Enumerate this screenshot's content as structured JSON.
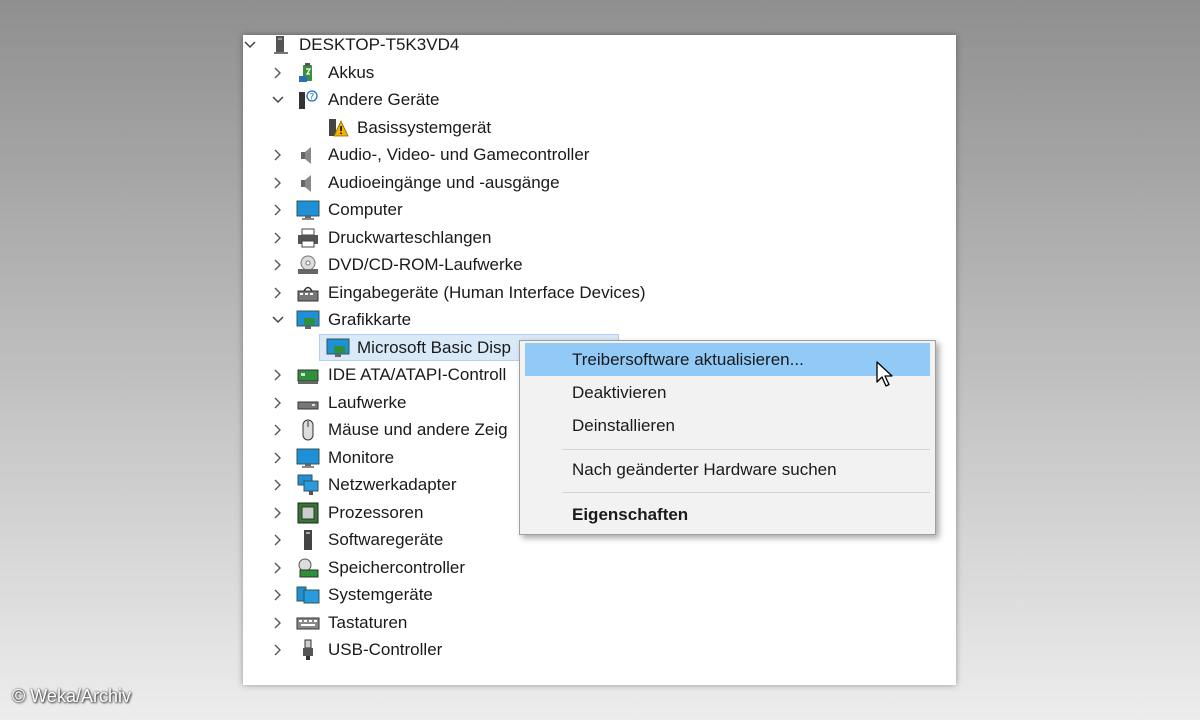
{
  "tree": {
    "root": "DESKTOP-T5K3VD4",
    "items": [
      {
        "label": "Akkus",
        "expanded": false,
        "icon": "battery-icon"
      },
      {
        "label": "Andere Geräte",
        "expanded": true,
        "icon": "unknown-device-icon"
      },
      {
        "label": "Basissystemgerät",
        "child": true,
        "icon": "warning-device-icon"
      },
      {
        "label": "Audio-, Video- und Gamecontroller",
        "expanded": false,
        "icon": "speaker-icon"
      },
      {
        "label": "Audioeingänge und -ausgänge",
        "expanded": false,
        "icon": "speaker-icon"
      },
      {
        "label": "Computer",
        "expanded": false,
        "icon": "monitor-icon"
      },
      {
        "label": "Druckwarteschlangen",
        "expanded": false,
        "icon": "printer-icon"
      },
      {
        "label": "DVD/CD-ROM-Laufwerke",
        "expanded": false,
        "icon": "disc-drive-icon"
      },
      {
        "label": "Eingabegeräte (Human Interface Devices)",
        "expanded": false,
        "icon": "hid-icon"
      },
      {
        "label": "Grafikkarte",
        "expanded": true,
        "icon": "display-adapter-icon"
      },
      {
        "label": "Microsoft Basic Disp",
        "child": true,
        "selected": true,
        "icon": "display-adapter-icon"
      },
      {
        "label": "IDE ATA/ATAPI-Controll",
        "expanded": false,
        "icon": "ide-controller-icon"
      },
      {
        "label": "Laufwerke",
        "expanded": false,
        "icon": "drive-icon"
      },
      {
        "label": "Mäuse und andere Zeig",
        "expanded": false,
        "icon": "mouse-icon"
      },
      {
        "label": "Monitore",
        "expanded": false,
        "icon": "monitor-icon"
      },
      {
        "label": "Netzwerkadapter",
        "expanded": false,
        "icon": "network-icon"
      },
      {
        "label": "Prozessoren",
        "expanded": false,
        "icon": "processor-icon"
      },
      {
        "label": "Softwaregeräte",
        "expanded": false,
        "icon": "software-device-icon"
      },
      {
        "label": "Speichercontroller",
        "expanded": false,
        "icon": "storage-controller-icon"
      },
      {
        "label": "Systemgeräte",
        "expanded": false,
        "icon": "system-device-icon"
      },
      {
        "label": "Tastaturen",
        "expanded": false,
        "icon": "keyboard-icon"
      },
      {
        "label": "USB-Controller",
        "expanded": false,
        "icon": "usb-icon"
      }
    ]
  },
  "context_menu": {
    "items": [
      {
        "label": "Treibersoftware aktualisieren...",
        "highlighted": true
      },
      {
        "label": "Deaktivieren"
      },
      {
        "label": "Deinstallieren"
      },
      {
        "label": "Nach geänderter Hardware suchen"
      },
      {
        "label": "Eigenschaften",
        "bold": true
      }
    ]
  },
  "credit": "© Weka/Archiv",
  "colors": {
    "menu_highlight": "#91c9f7",
    "selection": "#d9e9f8",
    "menu_bg": "#f2f2f2"
  }
}
